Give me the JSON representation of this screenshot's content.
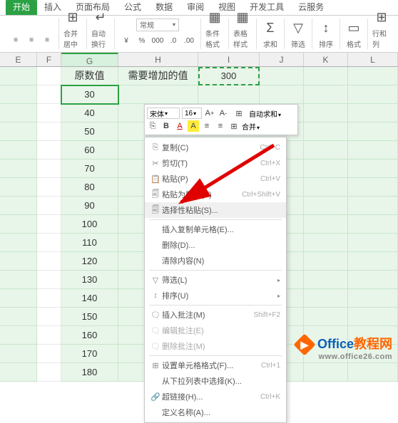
{
  "tabs": [
    "开始",
    "插入",
    "页面布局",
    "公式",
    "数据",
    "审阅",
    "视图",
    "开发工具",
    "云服务"
  ],
  "active_tab": "开始",
  "ribbon": {
    "merge_center": "合并居中",
    "wrap_text": "自动换行",
    "num_format": "常规",
    "cond_fmt": "条件格式",
    "table_fmt": "表格样式",
    "sum": "求和",
    "filter": "筛选",
    "sort": "排序",
    "format": "格式",
    "rowcol": "行和列"
  },
  "columns": [
    "E",
    "F",
    "G",
    "H",
    "I",
    "J",
    "K",
    "L"
  ],
  "headers": {
    "G": "原数值",
    "H": "需要增加的值",
    "I": "300"
  },
  "col_G_values": [
    30,
    40,
    50,
    60,
    70,
    80,
    90,
    100,
    110,
    120,
    130,
    140,
    150,
    160,
    170,
    180
  ],
  "mini": {
    "font": "宋体",
    "size": "16",
    "merge": "合并",
    "autosum": "自动求和"
  },
  "ctx": {
    "copy": {
      "label": "复制(C)",
      "sc": "Ctrl+C",
      "icon": "⎘"
    },
    "cut": {
      "label": "剪切(T)",
      "sc": "Ctrl+X",
      "icon": "✂"
    },
    "paste": {
      "label": "粘贴(P)",
      "sc": "Ctrl+V",
      "icon": "📋"
    },
    "paste_values": {
      "label": "粘贴为数值(V)",
      "sc": "Ctrl+Shift+V",
      "icon": "🗐"
    },
    "paste_special": {
      "label": "选择性粘贴(S)...",
      "icon": "🗐"
    },
    "insert_copied": {
      "label": "插入复制单元格(E)..."
    },
    "delete": {
      "label": "删除(D)..."
    },
    "clear": {
      "label": "清除内容(N)"
    },
    "filter": {
      "label": "筛选(L)",
      "icon": "▽"
    },
    "sort": {
      "label": "排序(U)",
      "icon": "↕"
    },
    "insert_comment": {
      "label": "插入批注(M)",
      "sc": "Shift+F2",
      "icon": "🗨"
    },
    "edit_comment": {
      "label": "编辑批注(E)",
      "icon": "🗨"
    },
    "delete_comment": {
      "label": "删除批注(M)",
      "icon": "🗨"
    },
    "format_cells": {
      "label": "设置单元格格式(F)...",
      "sc": "Ctrl+1",
      "icon": "⊞"
    },
    "pick_list": {
      "label": "从下拉列表中选择(K)..."
    },
    "hyperlink": {
      "label": "超链接(H)...",
      "sc": "Ctrl+K",
      "icon": "🔗"
    },
    "define_name": {
      "label": "定义名称(A)..."
    }
  },
  "watermark": {
    "blue": "Office",
    "orange": "教程网",
    "url": "www.office26.com"
  }
}
